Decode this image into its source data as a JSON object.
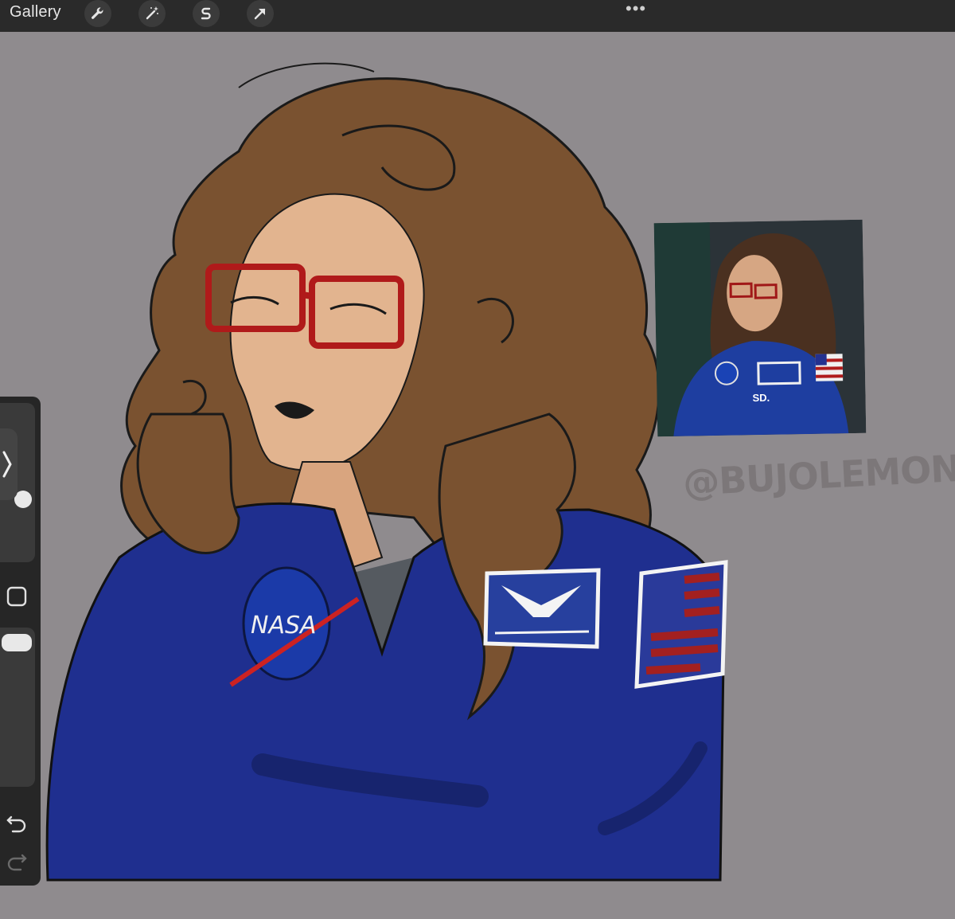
{
  "app": {
    "gallery_label": "Gallery",
    "more_menu": "•••"
  },
  "toolbar": {
    "tools": [
      {
        "name": "actions",
        "icon": "wrench-icon"
      },
      {
        "name": "adjustments",
        "icon": "magic-wand-icon"
      },
      {
        "name": "selection",
        "icon": "selection-s-icon"
      },
      {
        "name": "transform",
        "icon": "arrow-cursor-icon"
      }
    ]
  },
  "sidebar": {
    "brush_size_level": 0.55,
    "opacity_level": 0.95,
    "icons": [
      "expand-chevron-icon",
      "modify-square-icon",
      "undo-icon",
      "redo-icon"
    ]
  },
  "canvas": {
    "watermark": "@BUJOLEMONGLOW",
    "reference_photo_caption": "SD."
  },
  "colors": {
    "topbar": "#2a2a2a",
    "canvas_bg": "#8f8b8e",
    "suit_blue": "#1f2f8f",
    "hair_brown": "#7a5230",
    "skin": "#e2b48f",
    "glasses_red": "#b01a1a"
  }
}
